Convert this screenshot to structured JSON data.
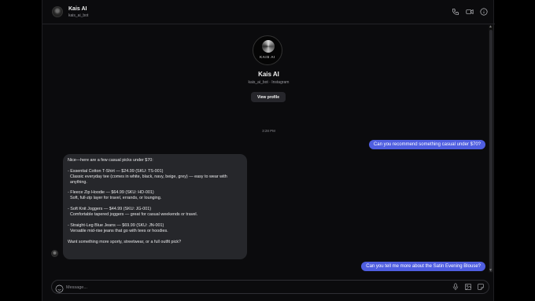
{
  "header": {
    "name": "Kais AI",
    "username": "kais_ai_bot",
    "icons": [
      "phone-icon",
      "video-icon",
      "info-icon"
    ]
  },
  "profile": {
    "logo_text": "KAIS AI",
    "name": "Kais AI",
    "subtitle": "kais_ai_bot · Instagram",
    "view_profile_label": "View profile"
  },
  "timestamp": "3:28 PM",
  "messages": {
    "outgoing_1": "Can you recommend something casual under $70?",
    "incoming": {
      "intro": "Nice—here are a few casual picks under $70:",
      "items": [
        {
          "title": "- Essential Cotton T-Shirt — $24.99 (SKU: TS-001)",
          "desc": "Classic everyday tee (comes in white, black, navy, beige, grey) — easy to wear with anything."
        },
        {
          "title": "- Fleece Zip Hoodie — $64.99 (SKU: HD-001)",
          "desc": "Soft, full-zip layer for travel, errands, or lounging."
        },
        {
          "title": "- Soft Knit Joggers — $44.99 (SKU: JG-001)",
          "desc": "Comfortable tapered joggers — great for casual weekends or travel."
        },
        {
          "title": "- Straight-Leg Blue Jeans — $69.99 (SKU: JN-001)",
          "desc": "Versatile mid-rise jeans that go with tees or hoodies."
        }
      ],
      "outro": "Want something more sporty, streetwear, or a full outfit pick?"
    },
    "outgoing_2": "Can you tell me more about the Satin Evening Blouse?"
  },
  "composer": {
    "placeholder": "Message...",
    "value": ""
  },
  "colors": {
    "background": "#0b0b0d",
    "outgoing_bubble": "#4f5ee0",
    "incoming_bubble": "#26272b"
  }
}
